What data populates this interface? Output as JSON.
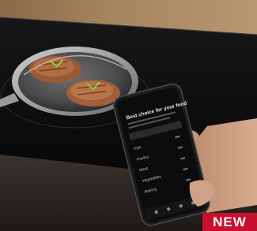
{
  "badge": {
    "label": "NEW",
    "color": "#c8102e"
  },
  "phone_screen": {
    "title": "Best choice for your food",
    "menu_items": [
      "Fish",
      "Poultry",
      "Meat",
      "Vegetables",
      "Baking"
    ]
  },
  "colors": {
    "wall": "#9d7b58",
    "cooktop": "#0f0f11",
    "pan": "#8e8e8e",
    "steak": "#a9653f",
    "phone": "#1c1c1e",
    "hand": "#c99b7f",
    "counter": "#2a2624"
  }
}
